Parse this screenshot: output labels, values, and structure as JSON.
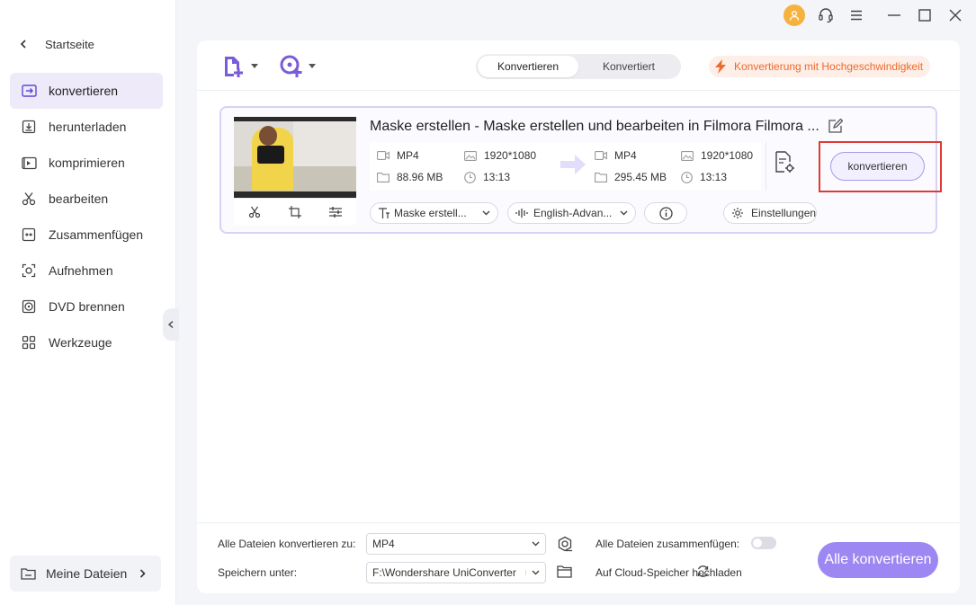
{
  "sidebar": {
    "back_label": "Startseite",
    "items": [
      {
        "label": "konvertieren",
        "icon": "convert-icon",
        "active": true
      },
      {
        "label": "herunterladen",
        "icon": "download-icon"
      },
      {
        "label": "komprimieren",
        "icon": "compress-icon"
      },
      {
        "label": "bearbeiten",
        "icon": "scissors-icon"
      },
      {
        "label": "Zusammenfügen",
        "icon": "merge-icon"
      },
      {
        "label": "Aufnehmen",
        "icon": "record-icon"
      },
      {
        "label": "DVD brennen",
        "icon": "dvd-icon"
      },
      {
        "label": "Werkzeuge",
        "icon": "tools-icon"
      }
    ],
    "my_files": "Meine Dateien"
  },
  "header": {
    "tabs": [
      "Konvertieren",
      "Konvertiert"
    ],
    "active_tab": "Konvertieren",
    "high_speed": "Konvertierung mit Hochgeschwindigkeit"
  },
  "file": {
    "title": "Maske erstellen - Maske erstellen und bearbeiten in Filmora  Filmora ...",
    "source": {
      "format": "MP4",
      "resolution": "1920*1080",
      "size": "88.96 MB",
      "duration": "13:13"
    },
    "target": {
      "format": "MP4",
      "resolution": "1920*1080",
      "size": "295.45 MB",
      "duration": "13:13"
    },
    "convert_button": "konvertieren",
    "subtitle_select": "Maske erstell...",
    "audio_select": "English-Advan...",
    "settings_label": "Einstellungen"
  },
  "footer": {
    "convert_all_to_label": "Alle Dateien konvertieren zu:",
    "convert_all_to_value": "MP4",
    "save_to_label": "Speichern unter:",
    "save_to_value": "F:\\Wondershare UniConverter",
    "merge_label": "Alle Dateien zusammenfügen:",
    "cloud_label": "Auf Cloud-Speicher hochladen",
    "convert_all_button": "Alle konvertieren"
  },
  "colors": {
    "accent": "#9d87f2",
    "highlight": "#e03a35",
    "speed": "#ee6a2c"
  }
}
